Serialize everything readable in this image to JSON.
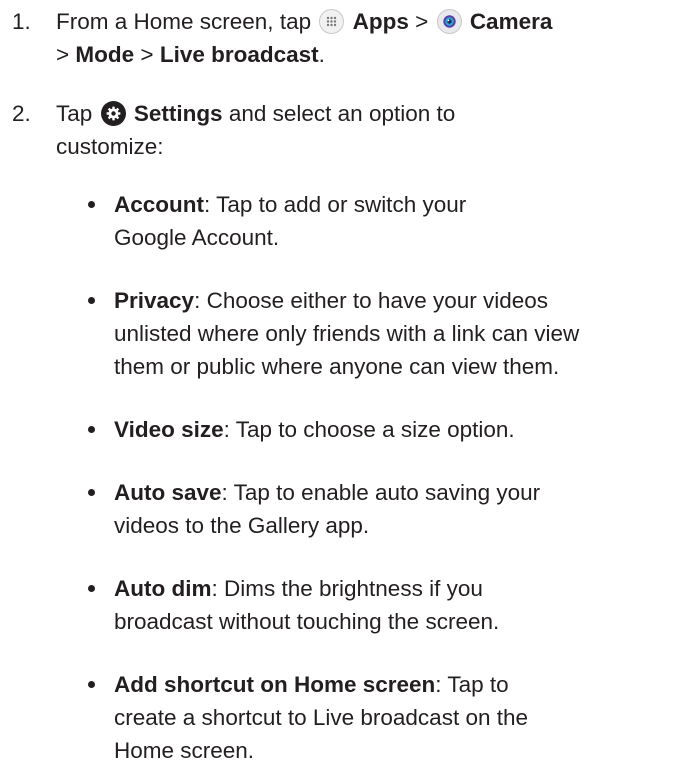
{
  "steps": [
    {
      "number": "1.",
      "line1_prefix": "From a Home screen, tap",
      "apps_label": "Apps",
      "sep1": ">",
      "camera_label": "Camera",
      "line2_sep1": ">",
      "mode_label": "Mode",
      "line2_sep2": ">",
      "live_label": "Live broadcast",
      "period": ".",
      "icons": [
        "apps-icon",
        "camera-icon"
      ]
    },
    {
      "number": "2.",
      "prefix": "Tap",
      "settings_label": "Settings",
      "line1_suffix": "and select an option to",
      "line2": "customize:",
      "icons": [
        "settings-icon"
      ]
    }
  ],
  "options": [
    {
      "label": "Account",
      "lines": [
        ": Tap to add or switch your",
        "Google Account."
      ]
    },
    {
      "label": "Privacy",
      "lines": [
        ": Choose either to have your videos",
        "unlisted where only friends with a link can view",
        "them or public where anyone can view them."
      ]
    },
    {
      "label": "Video size",
      "lines": [
        ": Tap to choose a size option."
      ]
    },
    {
      "label": "Auto save",
      "lines": [
        ": Tap to enable auto saving your",
        "videos to the Gallery app."
      ]
    },
    {
      "label": "Auto dim",
      "lines": [
        ": Dims the brightness if you",
        "broadcast without touching the screen."
      ]
    },
    {
      "label": "Add shortcut on Home screen",
      "lines": [
        ": Tap to",
        "create a shortcut to Live broadcast on the",
        "Home screen."
      ]
    }
  ],
  "colors": {
    "text": "#231f20",
    "background": "#ffffff"
  }
}
